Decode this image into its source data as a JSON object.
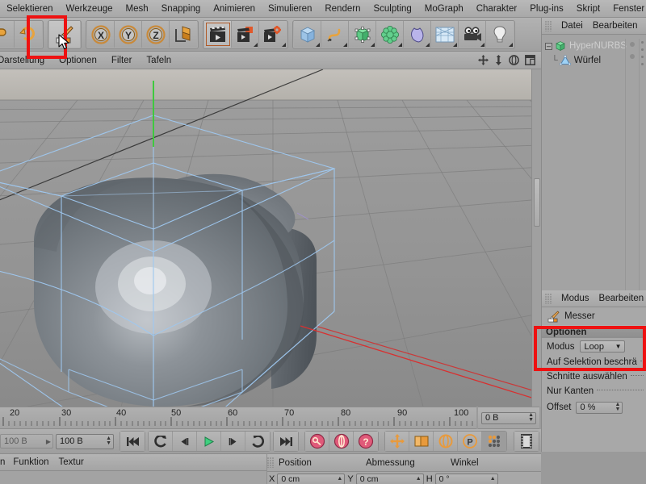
{
  "menubar": {
    "items": [
      {
        "label": "Selektieren"
      },
      {
        "label": "Werkzeuge"
      },
      {
        "label": "Mesh"
      },
      {
        "label": "Snapping"
      },
      {
        "label": "Animieren"
      },
      {
        "label": "Simulieren"
      },
      {
        "label": "Rendern"
      },
      {
        "label": "Sculpting"
      },
      {
        "label": "MoGraph"
      },
      {
        "label": "Charakter"
      },
      {
        "label": "Plug-ins"
      },
      {
        "label": "Skript"
      },
      {
        "label": "Fenster"
      }
    ]
  },
  "toolbar": {
    "groups": [
      {
        "name": "undo-group",
        "buttons": [
          {
            "name": "undo-icon",
            "label": "undo-icon"
          },
          {
            "name": "redo-icon",
            "label": "redo-icon"
          }
        ]
      },
      {
        "name": "tool-group",
        "buttons": [
          {
            "name": "knife-tool-icon",
            "label": "knife-tool-icon",
            "selected": true
          }
        ]
      },
      {
        "name": "axis-lock-group",
        "buttons": [
          {
            "name": "axis-x-button",
            "label": "X"
          },
          {
            "name": "axis-y-button",
            "label": "Y"
          },
          {
            "name": "axis-z-button",
            "label": "Z"
          },
          {
            "name": "world-object-axis-icon",
            "label": "world-object-axis-icon"
          }
        ]
      },
      {
        "name": "render-group",
        "buttons": [
          {
            "name": "render-view-icon",
            "label": "render-view-icon",
            "selected": true
          },
          {
            "name": "render-region-icon",
            "label": "render-region-icon"
          },
          {
            "name": "render-settings-icon",
            "label": "render-settings-icon"
          }
        ]
      },
      {
        "name": "create-group",
        "buttons": [
          {
            "name": "primitive-cube-icon",
            "label": "primitive-cube-icon"
          },
          {
            "name": "spline-pen-icon",
            "label": "spline-pen-icon"
          },
          {
            "name": "nurbs-generator-icon",
            "label": "nurbs-generator-icon"
          },
          {
            "name": "array-deformer-icon",
            "label": "array-deformer-icon"
          },
          {
            "name": "bend-deformer-icon",
            "label": "bend-deformer-icon"
          },
          {
            "name": "environment-floor-icon",
            "label": "environment-floor-icon"
          },
          {
            "name": "camera-icon",
            "label": "camera-icon"
          },
          {
            "name": "light-icon",
            "label": "light-icon"
          }
        ]
      }
    ]
  },
  "viewport": {
    "menu": [
      {
        "label": "Darstellung"
      },
      {
        "label": "Optionen"
      },
      {
        "label": "Filter"
      },
      {
        "label": "Tafeln"
      }
    ],
    "nav_icons": [
      {
        "name": "viewport-move-icon"
      },
      {
        "name": "viewport-dolly-icon"
      },
      {
        "name": "viewport-rotate-icon"
      },
      {
        "name": "viewport-maximize-icon"
      }
    ],
    "object": "rounded-cube-hypernurbs"
  },
  "object_manager": {
    "menu": [
      {
        "label": "Datei"
      },
      {
        "label": "Bearbeiten"
      }
    ],
    "tree": [
      {
        "label": "HyperNURBS",
        "icon": "hypernurbs-icon",
        "depth": 0,
        "dimmed": true,
        "expander": "–"
      },
      {
        "label": "Würfel",
        "icon": "cube-object-icon",
        "depth": 1,
        "dimmed": false,
        "expander": ""
      }
    ]
  },
  "attribute_manager": {
    "menu": [
      {
        "label": "Modus"
      },
      {
        "label": "Bearbeiten"
      }
    ],
    "tool_title": "Messer",
    "tool_icon": "knife-tool-icon",
    "section_title": "Optionen",
    "mode_label": "Modus",
    "mode_value": "Loop",
    "rows": [
      {
        "label": "Auf Selektion beschrä",
        "type": "checkbox"
      },
      {
        "label": "Schnitte auswählen",
        "type": "checkbox"
      },
      {
        "label": "Nur Kanten",
        "type": "checkbox"
      }
    ],
    "offset_label": "Offset",
    "offset_value": "0 %"
  },
  "timeline": {
    "ticks": [
      "20",
      "30",
      "40",
      "50",
      "60",
      "70",
      "80",
      "90",
      "100"
    ],
    "current_frame_field": "0 B"
  },
  "playbar": {
    "range_start_label": "100 B",
    "range_end_value": "100 B",
    "buttons": [
      {
        "name": "go-to-start-button",
        "label": "go-to-start-icon"
      },
      {
        "name": "play-reverse-button",
        "label": "play-reverse-icon"
      },
      {
        "name": "previous-frame-button",
        "label": "previous-frame-icon"
      },
      {
        "name": "play-forward-button",
        "label": "play-forward-icon"
      },
      {
        "name": "next-frame-button",
        "label": "next-frame-icon"
      },
      {
        "name": "loop-button",
        "label": "loop-icon"
      },
      {
        "name": "go-to-end-button",
        "label": "go-to-end-icon"
      }
    ],
    "key_buttons": [
      {
        "name": "record-keyframe-button",
        "label": "key-icon"
      },
      {
        "name": "autokeying-button",
        "label": "autokey-icon"
      },
      {
        "name": "keyframe-selection-button",
        "label": "question-icon"
      }
    ],
    "param_buttons": [
      {
        "name": "key-position-button",
        "label": "position-key-icon"
      },
      {
        "name": "key-scale-button",
        "label": "scale-key-icon"
      },
      {
        "name": "key-rotation-button",
        "label": "rotation-key-icon"
      },
      {
        "name": "key-parameter-button",
        "label": "parameter-key-icon"
      },
      {
        "name": "key-pla-button",
        "label": "pla-key-icon"
      }
    ],
    "timeline_button": {
      "name": "timeline-button",
      "label": "filmstrip-icon"
    }
  },
  "material_manager": {
    "menu": [
      {
        "label": "n"
      },
      {
        "label": "Funktion"
      },
      {
        "label": "Textur"
      }
    ]
  },
  "coordinate_manager": {
    "headers": [
      "Position",
      "Abmessung",
      "Winkel"
    ],
    "fields": [
      {
        "axis": "X",
        "value": "0 cm"
      },
      {
        "axis": "Y",
        "value": "0 cm"
      },
      {
        "axis": "H",
        "value": "0 °"
      }
    ]
  },
  "annotations": {
    "highlight_color": "#ee1111",
    "boxes": [
      {
        "name": "knife-tool-highlight"
      },
      {
        "name": "knife-options-highlight"
      }
    ]
  }
}
